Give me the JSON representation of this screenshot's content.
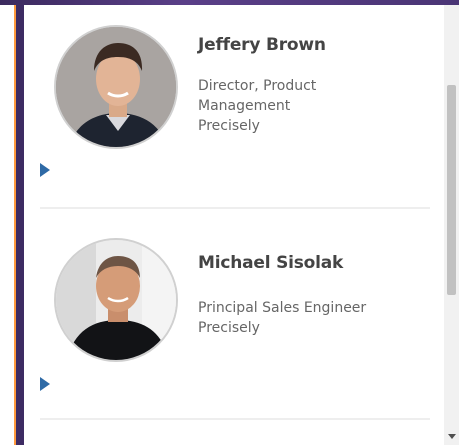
{
  "speakers": [
    {
      "name": "Jeffery Brown",
      "role_line1": "Director, Product",
      "role_line2": "Management",
      "company": "Precisely"
    },
    {
      "name": "Michael Sisolak",
      "role_line1": "Principal Sales Engineer",
      "company": "Precisely"
    }
  ],
  "colors": {
    "play_icon": "#2e6aa6",
    "frame_accent": "#ff9a3d",
    "frame_purple": "#3d2b63"
  }
}
